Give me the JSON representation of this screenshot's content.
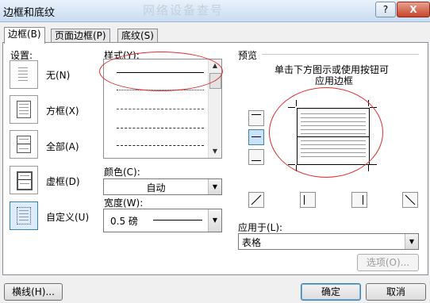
{
  "window": {
    "title": "边框和底纹",
    "watermark": "网络设备查号",
    "help": "?",
    "close": "X"
  },
  "tabs": [
    {
      "label": "边框(B)",
      "active": true
    },
    {
      "label": "页面边框(P)",
      "active": false
    },
    {
      "label": "底纹(S)",
      "active": false
    }
  ],
  "settings": {
    "label": "设置:",
    "items": [
      {
        "label": "无(N)"
      },
      {
        "label": "方框(X)"
      },
      {
        "label": "全部(A)"
      },
      {
        "label": "虚框(D)"
      },
      {
        "label": "自定义(U)"
      }
    ]
  },
  "style": {
    "label": "样式(Y):"
  },
  "color": {
    "label": "颜色(C):",
    "value": "自动"
  },
  "width": {
    "label": "宽度(W):",
    "value": "0.5 磅"
  },
  "preview": {
    "label": "预览",
    "hint_line1": "单击下方图示或使用按钮可",
    "hint_line2": "应用边框"
  },
  "apply_to": {
    "label": "应用于(L):",
    "value": "表格"
  },
  "buttons": {
    "options": "选项(O)...",
    "horizontal_line": "横线(H)...",
    "ok": "确定",
    "cancel": "取消"
  }
}
